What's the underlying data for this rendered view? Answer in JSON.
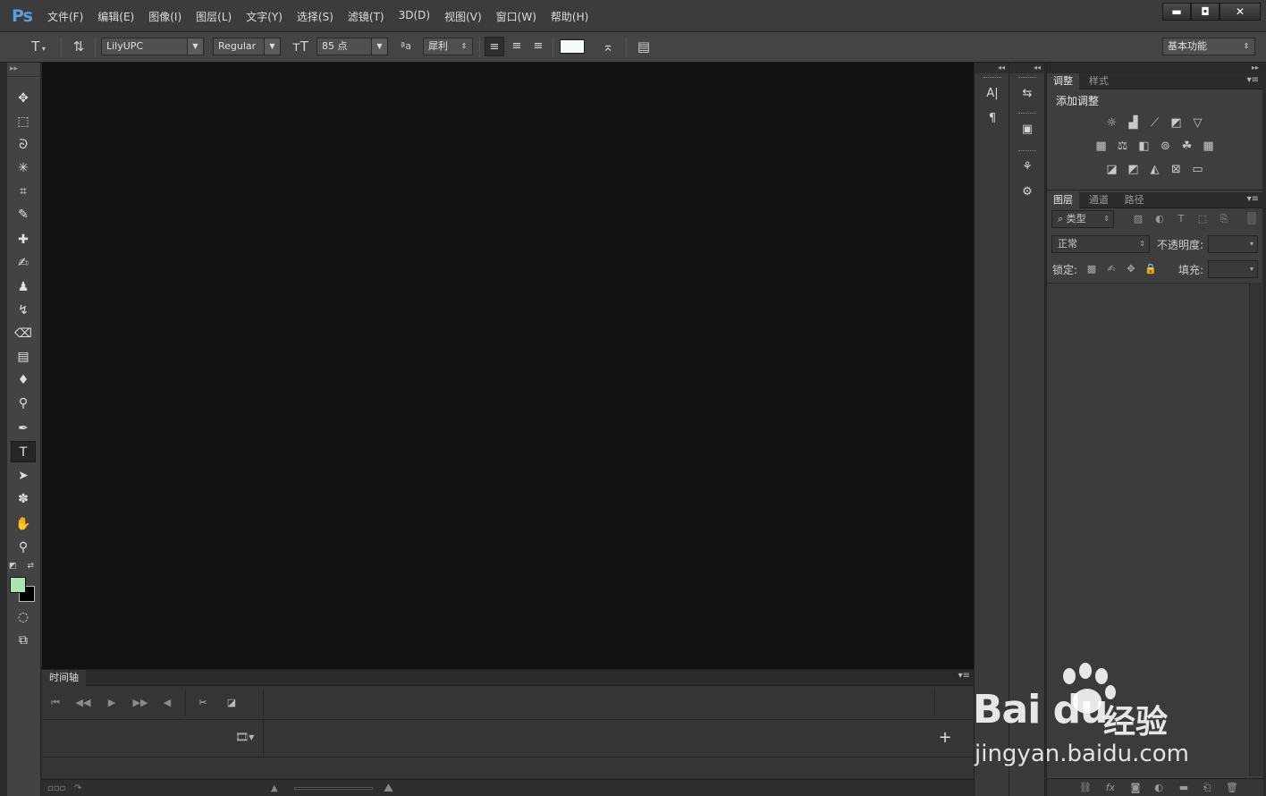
{
  "app": {
    "logo": "Ps",
    "menu": [
      "文件(F)",
      "编辑(E)",
      "图像(I)",
      "图层(L)",
      "文字(Y)",
      "选择(S)",
      "滤镜(T)",
      "3D(D)",
      "视图(V)",
      "窗口(W)",
      "帮助(H)"
    ],
    "window_controls": {
      "minimize": "▬",
      "maximize": "◘",
      "close": "✕"
    }
  },
  "options_bar": {
    "tool_icon": "type-tool-icon",
    "font_family": "LilyUPC",
    "font_style": "Regular",
    "font_size": "85 点",
    "antialias_label": "ªa",
    "antialias": "犀利",
    "text_color": "#f5fcfa",
    "workspace": "基本功能"
  },
  "toolbox": {
    "tools": [
      {
        "name": "move-tool-icon",
        "glyph": "✥"
      },
      {
        "name": "rectangular-marquee-icon",
        "glyph": "⬚"
      },
      {
        "name": "lasso-icon",
        "glyph": "ᘐ"
      },
      {
        "name": "magic-wand-icon",
        "glyph": "✳"
      },
      {
        "name": "crop-icon",
        "glyph": "⌗"
      },
      {
        "name": "eyedropper-icon",
        "glyph": "✎"
      },
      {
        "name": "healing-brush-icon",
        "glyph": "✚"
      },
      {
        "name": "brush-icon",
        "glyph": "✍"
      },
      {
        "name": "clone-stamp-icon",
        "glyph": "♟"
      },
      {
        "name": "history-brush-icon",
        "glyph": "↯"
      },
      {
        "name": "eraser-icon",
        "glyph": "⌫"
      },
      {
        "name": "gradient-icon",
        "glyph": "▤"
      },
      {
        "name": "blur-icon",
        "glyph": "💧"
      },
      {
        "name": "dodge-icon",
        "glyph": "⚲"
      },
      {
        "name": "pen-icon",
        "glyph": "✒"
      },
      {
        "name": "type-tool-icon",
        "glyph": "T"
      },
      {
        "name": "path-selection-icon",
        "glyph": "➤"
      },
      {
        "name": "custom-shape-icon",
        "glyph": "✽"
      },
      {
        "name": "hand-icon",
        "glyph": "✋"
      },
      {
        "name": "zoom-icon",
        "glyph": "🔍"
      }
    ],
    "foreground_color": "#a7e6b4",
    "background_color": "#000000"
  },
  "timeline": {
    "tab": "时间轴"
  },
  "panels": {
    "adjust_tabs": [
      "调整",
      "样式"
    ],
    "adjust_title": "添加调整",
    "layers_tabs": [
      "图层",
      "通道",
      "路径"
    ],
    "filter_type": "类型",
    "blend_mode": "正常",
    "opacity_label": "不透明度:",
    "lock_label": "锁定:",
    "fill_label": "填充:"
  },
  "watermark": {
    "logo": "Bai du",
    "brand": "经验",
    "url": "jingyan.baidu.com"
  }
}
